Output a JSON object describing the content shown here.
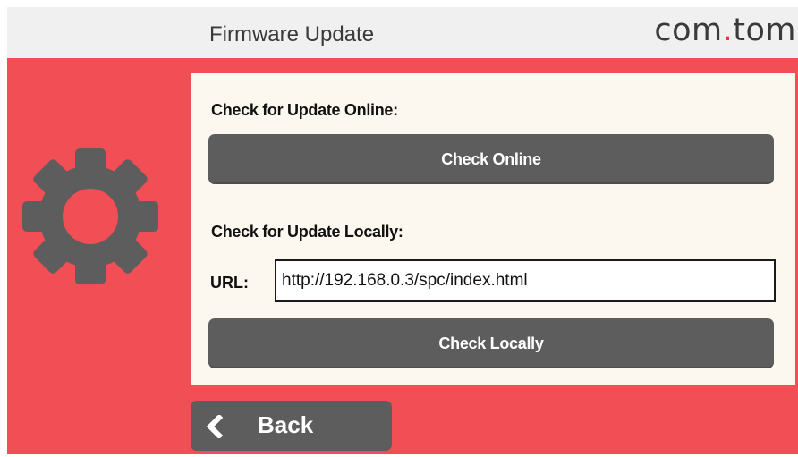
{
  "header": {
    "title": "Firmware Update",
    "brand_part1": "com",
    "brand_dot": ".",
    "brand_part2": "tom"
  },
  "icons": {
    "settings": "gear-icon",
    "back": "chevron-left-icon"
  },
  "online": {
    "label": "Check for Update Online:",
    "button": "Check Online"
  },
  "local": {
    "label": "Check for Update Locally:",
    "url_label": "URL:",
    "url_value": "http://192.168.0.3/spc/index.html",
    "button": "Check Locally"
  },
  "footer": {
    "back_label": "Back"
  },
  "colors": {
    "background": "#f24e55",
    "header": "#f0f0f0",
    "panel": "#fcf8ef",
    "button": "#5d5d5d",
    "brand_dot": "#e8343c",
    "text_dark": "#3a3a3a"
  }
}
